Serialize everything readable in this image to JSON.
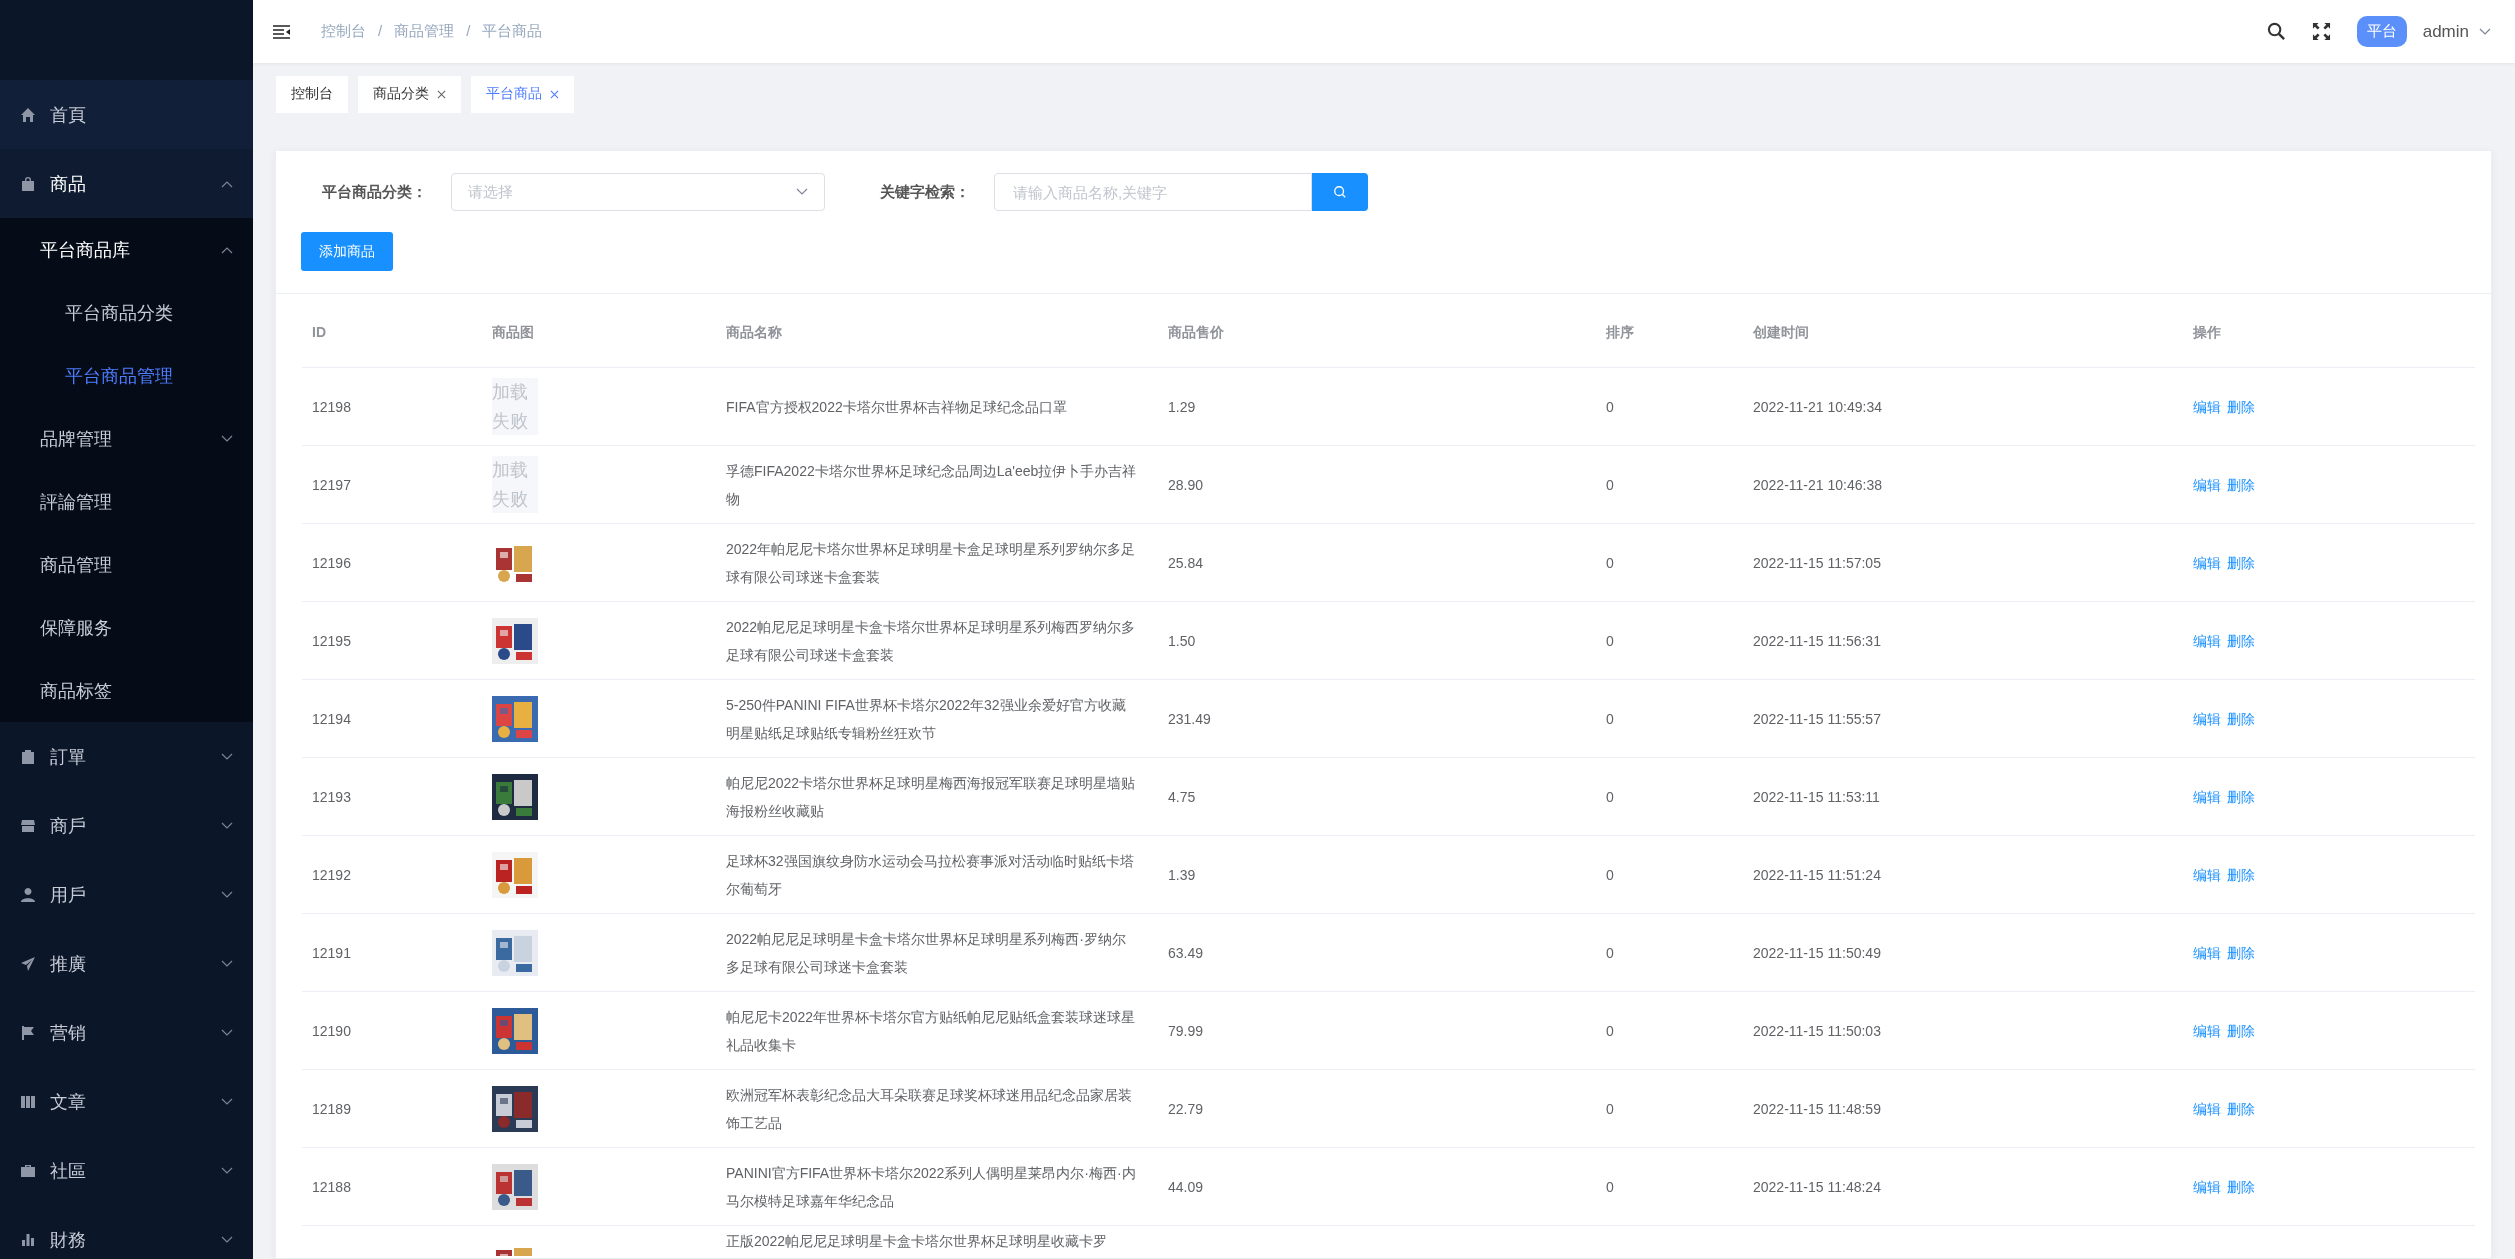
{
  "sidebar": {
    "items": [
      {
        "label": "首頁",
        "selected": false
      },
      {
        "label": "商品",
        "selected": false,
        "expanded": true,
        "children": [
          {
            "label": "平台商品库",
            "selected": false,
            "expanded": true,
            "children": [
              {
                "label": "平台商品分类",
                "selected": false
              },
              {
                "label": "平台商品管理",
                "selected": true
              }
            ]
          },
          {
            "label": "品牌管理",
            "selected": false,
            "expanded": false
          },
          {
            "label": "評論管理",
            "selected": false
          },
          {
            "label": "商品管理",
            "selected": false
          },
          {
            "label": "保障服务",
            "selected": false
          },
          {
            "label": "商品标签",
            "selected": false
          }
        ]
      },
      {
        "label": "訂單",
        "selected": false,
        "expanded": false
      },
      {
        "label": "商戶",
        "selected": false,
        "expanded": false
      },
      {
        "label": "用戶",
        "selected": false,
        "expanded": false
      },
      {
        "label": "推廣",
        "selected": false,
        "expanded": false
      },
      {
        "label": "营销",
        "selected": false,
        "expanded": false
      },
      {
        "label": "文章",
        "selected": false,
        "expanded": false
      },
      {
        "label": "社區",
        "selected": false,
        "expanded": false
      },
      {
        "label": "財務",
        "selected": false,
        "expanded": false
      }
    ]
  },
  "header": {
    "breadcrumb": [
      {
        "label": "控制台"
      },
      {
        "separator": "/",
        "label": "商品管理"
      },
      {
        "separator": "/",
        "label": "平台商品"
      }
    ],
    "role_badge": "平台",
    "user": "admin"
  },
  "tabs": [
    {
      "label": "控制台",
      "selected": false,
      "closable": false
    },
    {
      "label": "商品分类",
      "selected": false,
      "closable": true
    },
    {
      "label": "平台商品",
      "selected": true,
      "closable": true
    }
  ],
  "filters": {
    "category_label": "平台商品分类：",
    "category_placeholder": "请选择",
    "keyword_label": "关键字检索：",
    "keyword_placeholder": "请输入商品名称,关键字"
  },
  "add_button": "添加商品",
  "table": {
    "columns": [
      "ID",
      "商品图",
      "商品名称",
      "商品售价",
      "排序",
      "创建时间",
      "操作"
    ],
    "rows": [
      {
        "id": "12198",
        "image": {
          "kind": "failed",
          "text": "加载失败"
        },
        "name": "FIFA官方授权2022卡塔尔世界杯吉祥物足球纪念品口罩",
        "price": "1.29",
        "sort": "0",
        "created": "2022-11-21 10:49:34",
        "actions": [
          "编辑",
          "删除"
        ]
      },
      {
        "id": "12197",
        "image": {
          "kind": "failed",
          "text": "加载失败"
        },
        "name": "孚德FIFA2022卡塔尔世界杯足球纪念品周边La'eeb拉伊卜手办吉祥物",
        "price": "28.90",
        "sort": "0",
        "created": "2022-11-21 10:46:38",
        "actions": [
          "编辑",
          "删除"
        ]
      },
      {
        "id": "12196",
        "image": {
          "kind": "picture"
        },
        "name": "2022年帕尼尼卡塔尔世界杯足球明星卡盒足球明星系列罗纳尔多足球有限公司球迷卡盒套装",
        "price": "25.84",
        "sort": "0",
        "created": "2022-11-15 11:57:05",
        "actions": [
          "编辑",
          "删除"
        ]
      },
      {
        "id": "12195",
        "image": {
          "kind": "picture"
        },
        "name": "2022帕尼尼足球明星卡盒卡塔尔世界杯足球明星系列梅西罗纳尔多足球有限公司球迷卡盒套装",
        "price": "1.50",
        "sort": "0",
        "created": "2022-11-15 11:56:31",
        "actions": [
          "编辑",
          "删除"
        ]
      },
      {
        "id": "12194",
        "image": {
          "kind": "picture"
        },
        "name": "5-250件PANINI FIFA世界杯卡塔尔2022年32强业余爱好官方收藏明星贴纸足球贴纸专辑粉丝狂欢节",
        "price": "231.49",
        "sort": "0",
        "created": "2022-11-15 11:55:57",
        "actions": [
          "编辑",
          "删除"
        ]
      },
      {
        "id": "12193",
        "image": {
          "kind": "picture"
        },
        "name": "帕尼尼2022卡塔尔世界杯足球明星梅西海报冠军联赛足球明星墙贴海报粉丝收藏贴",
        "price": "4.75",
        "sort": "0",
        "created": "2022-11-15 11:53:11",
        "actions": [
          "编辑",
          "删除"
        ]
      },
      {
        "id": "12192",
        "image": {
          "kind": "picture"
        },
        "name": "足球杯32强国旗纹身防水运动会马拉松赛事派对活动临时贴纸卡塔尔葡萄牙",
        "price": "1.39",
        "sort": "0",
        "created": "2022-11-15 11:51:24",
        "actions": [
          "编辑",
          "删除"
        ]
      },
      {
        "id": "12191",
        "image": {
          "kind": "picture"
        },
        "name": "2022帕尼尼足球明星卡盒卡塔尔世界杯足球明星系列梅西·罗纳尔多足球有限公司球迷卡盒套装",
        "price": "63.49",
        "sort": "0",
        "created": "2022-11-15 11:50:49",
        "actions": [
          "编辑",
          "删除"
        ]
      },
      {
        "id": "12190",
        "image": {
          "kind": "picture"
        },
        "name": "帕尼尼卡2022年世界杯卡塔尔官方贴纸帕尼尼贴纸盒套装球迷球星礼品收集卡",
        "price": "79.99",
        "sort": "0",
        "created": "2022-11-15 11:50:03",
        "actions": [
          "编辑",
          "删除"
        ]
      },
      {
        "id": "12189",
        "image": {
          "kind": "picture"
        },
        "name": "欧洲冠军杯表彰纪念品大耳朵联赛足球奖杯球迷用品纪念品家居装饰工艺品",
        "price": "22.79",
        "sort": "0",
        "created": "2022-11-15 11:48:59",
        "actions": [
          "编辑",
          "删除"
        ]
      },
      {
        "id": "12188",
        "image": {
          "kind": "picture"
        },
        "name": "PANINI官方FIFA世界杯卡塔尔2022系列人偶明星莱昂内尔·梅西·内马尔模特足球嘉年华纪念品",
        "price": "44.09",
        "sort": "0",
        "created": "2022-11-15 11:48:24",
        "actions": [
          "编辑",
          "删除"
        ]
      },
      {
        "image": {
          "kind": "picture"
        },
        "name": "正版2022帕尼尼足球明星卡盒卡塔尔世界杯足球明星收藏卡罗"
      }
    ]
  }
}
